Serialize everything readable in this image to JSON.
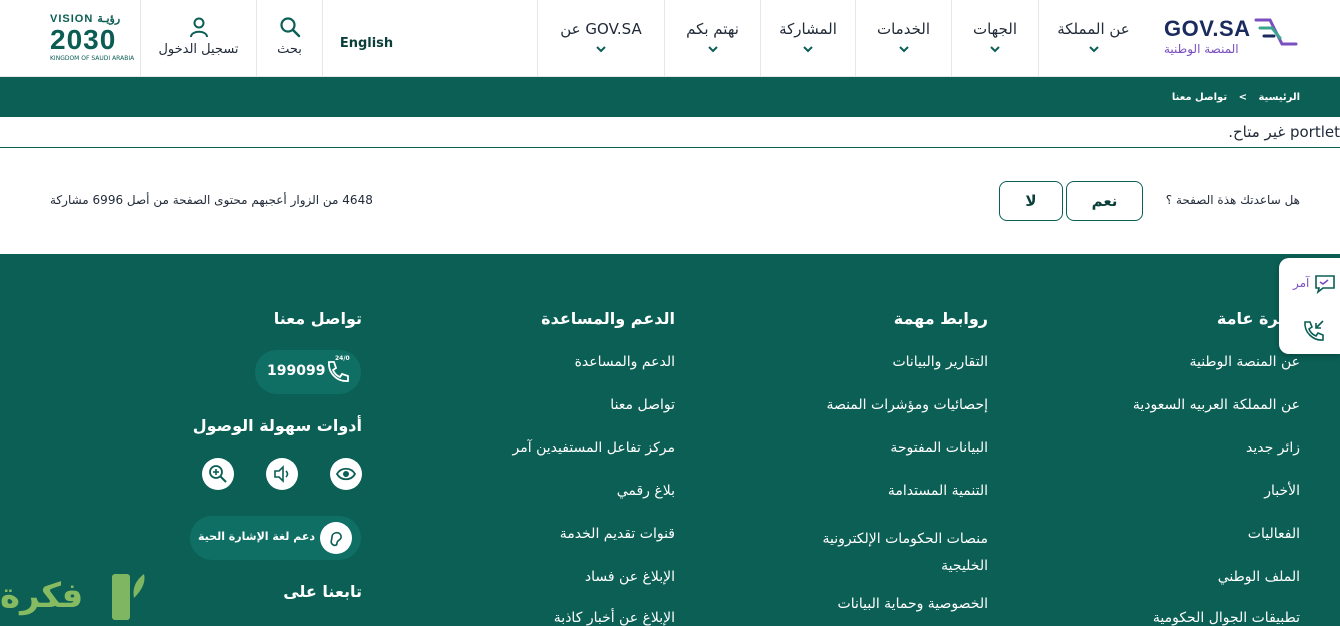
{
  "header": {
    "logo_text": "GOV.SA",
    "logo_subtitle": "المنصة الوطنية",
    "nav": [
      {
        "label": "عن المملكة"
      },
      {
        "label": "الجهات"
      },
      {
        "label": "الخدمات"
      },
      {
        "label": "المشاركة"
      },
      {
        "label": "نهتم بكم"
      },
      {
        "label": "عن GOV.SA"
      }
    ],
    "language_label": "English",
    "search_label": "بحث",
    "login_label": "تسجيل الدخول",
    "vision": {
      "line1": "VISION رؤيـة",
      "line2": "2030",
      "line3": "KINGDOM OF SAUDI ARABIA"
    }
  },
  "breadcrumb": {
    "home": "الرئيسية",
    "separator": ">",
    "current": "تواصل معنا"
  },
  "notice": "portlet غير متاح.",
  "feedback": {
    "question": "هل ساعدتك هذة الصفحة ؟",
    "yes_label": "نعم",
    "no_label": "لا",
    "stats": "4648 من الزوار أعجبهم محتوى الصفحة من أصل 6996 مشاركة"
  },
  "footer": {
    "col1": {
      "title": "نظرة عامة",
      "links": [
        "عن المنصة الوطنية",
        "عن المملكة العربيه السعودية",
        "زائر جديد",
        "الأخبار",
        "الفعاليات",
        "الملف الوطني",
        "تطبيقات الجوال الحكومية"
      ]
    },
    "col2": {
      "title": "روابط مهمة",
      "links": [
        "التقارير والبيانات",
        "إحصائيات ومؤشرات المنصة",
        "البيانات المفتوحة",
        "التنمية المستدامة",
        "منصات الحكومات الإلكترونية الخليجية",
        "الخصوصية وحماية البيانات"
      ]
    },
    "col3": {
      "title": "الدعم والمساعدة",
      "links": [
        "الدعم والمساعدة",
        "تواصل معنا",
        "مركز تفاعل المستفيدين آمر",
        "بلاغ رقمي",
        "قنوات تقديم الخدمة",
        "الإبلاغ عن فساد",
        "الإبلاغ عن أخبار كاذبة"
      ]
    },
    "col4": {
      "title": "تواصل معنا",
      "phone": "199099",
      "phone_badge": "24/0",
      "accessibility_title": "أدوات سهولة الوصول",
      "sign_language_label": "دعم لغة الإشارة الحية",
      "follow_title": "تابعنا على"
    }
  },
  "side_tab": {
    "amer_label": "آمر"
  },
  "watermark": "فكرة",
  "colors": {
    "primary": "#0b5f55",
    "text": "#1f2937",
    "accent": "#7a4fbf"
  }
}
